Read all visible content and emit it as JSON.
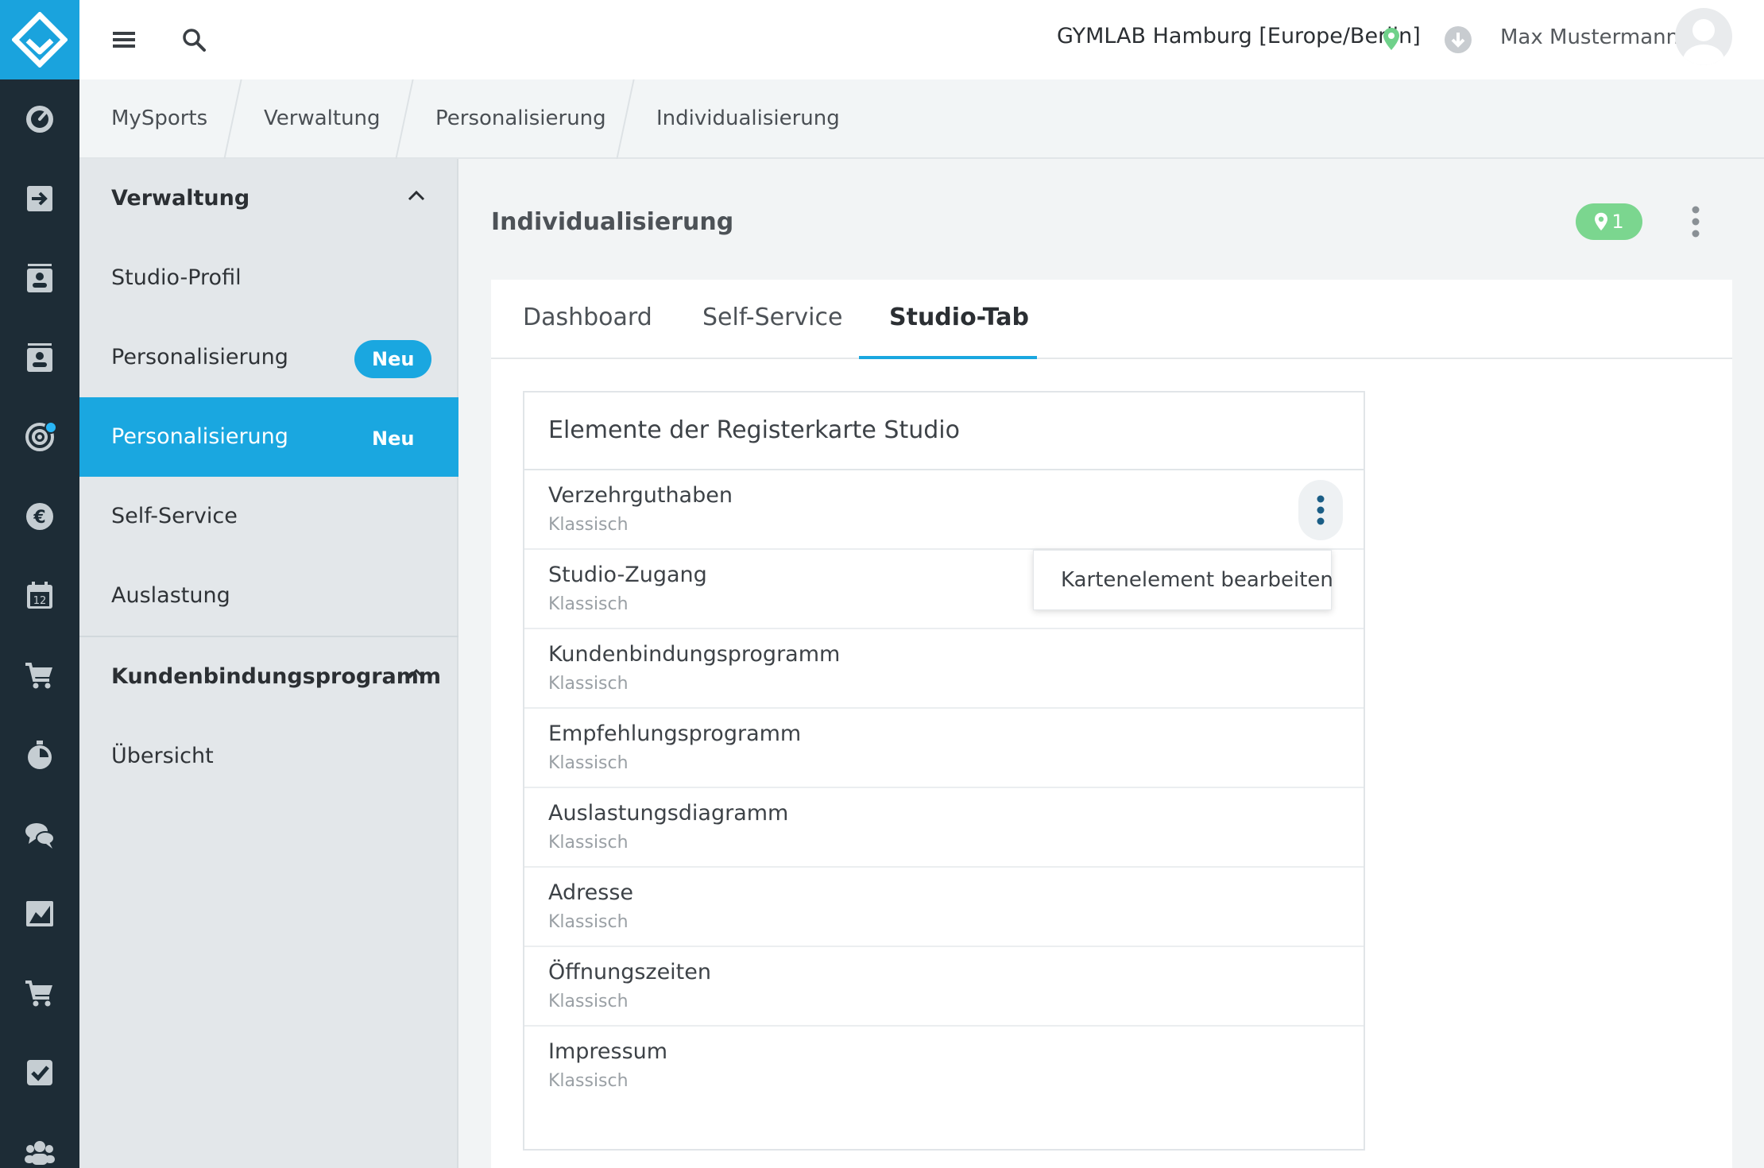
{
  "topbar": {
    "studio": "GYMLAB Hamburg [Europe/Berlin]",
    "user": "Max Mustermann"
  },
  "breadcrumb": [
    "MySports",
    "Verwaltung",
    "Personalisierung",
    "Individualisierung"
  ],
  "sidebar": {
    "sections": [
      {
        "title": "Verwaltung",
        "items": [
          {
            "label": "Studio-Profil"
          },
          {
            "label": "Personalisierung",
            "badge": "Neu"
          },
          {
            "label": "Personalisierung",
            "badge": "Neu",
            "active": true
          },
          {
            "label": "Self-Service"
          },
          {
            "label": "Auslastung"
          }
        ]
      },
      {
        "title": "Kundenbindungsprogramm",
        "items": [
          {
            "label": "Übersicht"
          }
        ]
      }
    ]
  },
  "main": {
    "title": "Individualisierung",
    "location_count": "1",
    "tabs": [
      {
        "label": "Dashboard"
      },
      {
        "label": "Self-Service"
      },
      {
        "label": "Studio-Tab",
        "active": true
      }
    ],
    "panel": {
      "title": "Elemente der Registerkarte Studio",
      "rows": [
        {
          "title": "Verzehrguthaben",
          "subtitle": "Klassisch"
        },
        {
          "title": "Studio-Zugang",
          "subtitle": "Klassisch"
        },
        {
          "title": "Kundenbindungsprogramm",
          "subtitle": "Klassisch"
        },
        {
          "title": "Empfehlungsprogramm",
          "subtitle": "Klassisch"
        },
        {
          "title": "Auslastungsdiagramm",
          "subtitle": "Klassisch"
        },
        {
          "title": "Adresse",
          "subtitle": "Klassisch"
        },
        {
          "title": "Öffnungszeiten",
          "subtitle": "Klassisch"
        },
        {
          "title": "Impressum",
          "subtitle": "Klassisch"
        }
      ]
    },
    "context_menu": {
      "item": "Kartenelement bearbeiten"
    }
  },
  "colors": {
    "accent": "#1aa7e0",
    "rail": "#1d2c36",
    "success": "#7bd68f"
  },
  "icons": {
    "rail": [
      "dashboard-icon",
      "checkin-icon",
      "contacts-icon",
      "members-icon",
      "target-icon",
      "euro-icon",
      "calendar-icon",
      "cart-icon",
      "timer-icon",
      "chat-icon",
      "chart-icon",
      "shop-icon",
      "tasks-icon",
      "users-icon"
    ],
    "topbar": [
      "menu-icon",
      "search-icon",
      "location-pin-icon",
      "download-icon",
      "avatar"
    ]
  }
}
